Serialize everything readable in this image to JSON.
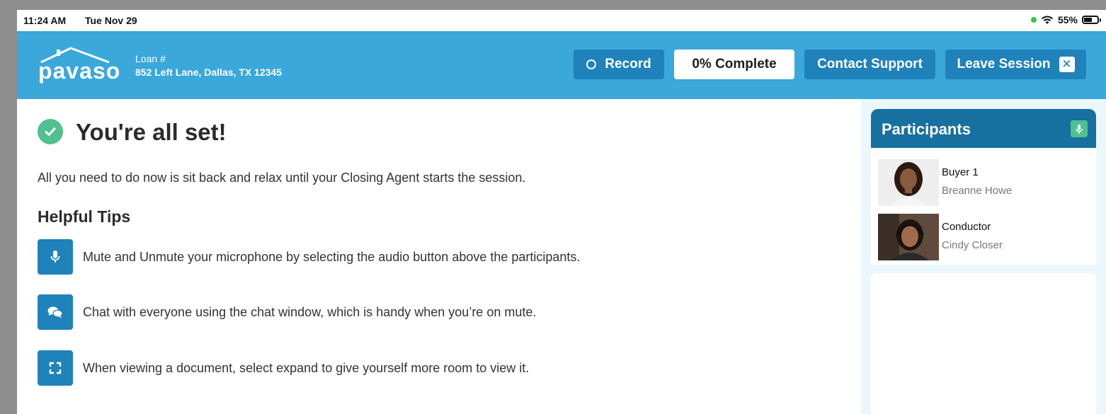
{
  "status_bar": {
    "time": "11:24 AM",
    "date": "Tue Nov 29",
    "battery": "55%"
  },
  "header": {
    "logo": "pavaso",
    "loan_label": "Loan #",
    "address": "852 Left Lane, Dallas, TX 12345",
    "record_label": "Record",
    "complete_label": "0% Complete",
    "support_label": "Contact Support",
    "leave_label": "Leave Session"
  },
  "main": {
    "title": "You're all set!",
    "intro": "All you need to do now is sit back and relax until your Closing Agent starts the session.",
    "tips_title": "Helpful Tips",
    "tips": [
      {
        "icon": "microphone-icon",
        "text": "Mute and Unmute your microphone by selecting the audio button above the participants."
      },
      {
        "icon": "chat-icon",
        "text": "Chat with everyone using the chat window, which is handy when you’re on mute."
      },
      {
        "icon": "expand-icon",
        "text": "When viewing a document, select expand to give yourself more room to view it."
      }
    ]
  },
  "participants": {
    "title": "Participants",
    "list": [
      {
        "role": "Buyer 1",
        "name": "Breanne Howe"
      },
      {
        "role": "Conductor",
        "name": "Cindy Closer"
      }
    ]
  },
  "colors": {
    "header_bg": "#3aa8da",
    "button_bg": "#1f82ba",
    "panel_header": "#17709f",
    "success_green": "#4fc08f"
  }
}
